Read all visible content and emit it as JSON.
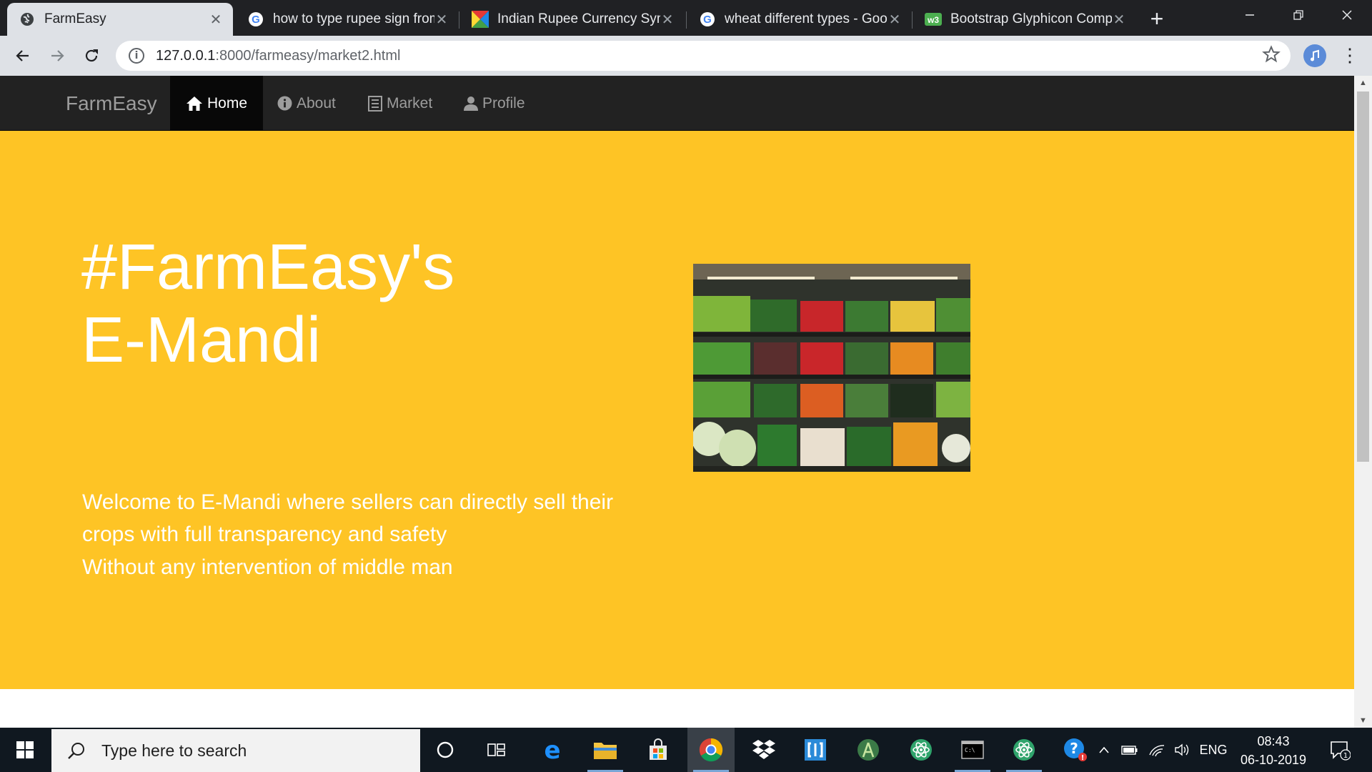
{
  "browser": {
    "tabs": [
      {
        "title": "FarmEasy",
        "active": true,
        "icon": "globe-icon"
      },
      {
        "title": "how to type rupee sign from",
        "active": false,
        "icon": "google-icon"
      },
      {
        "title": "Indian Rupee Currency Sym",
        "active": false,
        "icon": "colorful-x-icon"
      },
      {
        "title": "wheat different types - Goo",
        "active": false,
        "icon": "google-icon"
      },
      {
        "title": "Bootstrap Glyphicon Comp",
        "active": false,
        "icon": "w3-icon"
      }
    ],
    "tab_close": "✕",
    "new_tab": "+",
    "url_host": "127.0.0.1",
    "url_path": ":8000/farmeasy/market2.html",
    "info_glyph": "i"
  },
  "navbar": {
    "brand": "FarmEasy",
    "links": [
      {
        "label": "Home",
        "icon": "home-icon",
        "active": true
      },
      {
        "label": "About",
        "icon": "info-sign-icon",
        "active": false
      },
      {
        "label": "Market",
        "icon": "list-alt-icon",
        "active": false
      },
      {
        "label": "Profile",
        "icon": "user-icon",
        "active": false
      }
    ]
  },
  "hero": {
    "title_line1": "#FarmEasy's",
    "title_line2": "E-Mandi",
    "paragraph1": "Welcome to E-Mandi where sellers can directly sell their crops with full transparency and safety",
    "paragraph2": "Without any intervention of middle man",
    "image": "vegetable-market-shelves"
  },
  "taskbar": {
    "search_placeholder": "Type here to search",
    "language": "ENG",
    "time": "08:43",
    "date": "06-10-2019",
    "notification_count": "1"
  },
  "colors": {
    "jumbotron": "#fec425",
    "navbar": "#222222",
    "navbar_active": "#080808",
    "browser_chrome": "#202124",
    "toolbar": "#dee1e6",
    "taskbar": "#101820"
  }
}
